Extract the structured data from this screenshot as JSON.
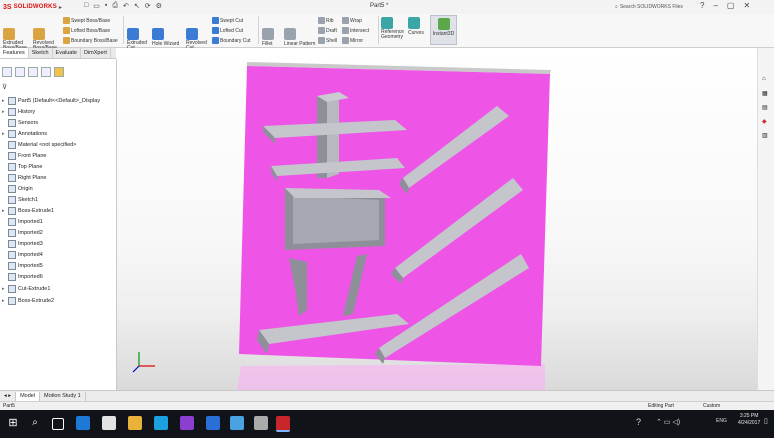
{
  "titlebar": {
    "app_name": "SOLIDWORKS",
    "ds_mark": "3S",
    "document_title": "Part5 *",
    "search_placeholder": "Search SOLIDWORKS Files",
    "quick_icons": [
      "new-icon",
      "open-icon",
      "save-icon",
      "print-icon",
      "undo-icon",
      "select-icon",
      "rebuild-icon",
      "options-icon"
    ]
  },
  "ribbon": {
    "buttons": [
      {
        "label": "Extruded Boss/Base"
      },
      {
        "label": "Revolved Boss/Base"
      },
      {
        "label": "Swept Boss/Base"
      },
      {
        "label": "Lofted Boss/Base"
      },
      {
        "label": "Boundary Boss/Base"
      },
      {
        "label": "Extruded Cut"
      },
      {
        "label": "Hole Wizard"
      },
      {
        "label": "Revolved Cut"
      },
      {
        "label": "Swept Cut"
      },
      {
        "label": "Lofted Cut"
      },
      {
        "label": "Boundary Cut"
      },
      {
        "label": "Fillet"
      },
      {
        "label": "Linear Pattern"
      },
      {
        "label": "Rib"
      },
      {
        "label": "Draft"
      },
      {
        "label": "Shell"
      },
      {
        "label": "Wrap"
      },
      {
        "label": "Intersect"
      },
      {
        "label": "Mirror"
      },
      {
        "label": "Reference Geometry"
      },
      {
        "label": "Curves"
      },
      {
        "label": "Instant3D"
      }
    ]
  },
  "feature_tabs": [
    "Features",
    "Sketch",
    "Evaluate",
    "DimXpert"
  ],
  "tree": [
    {
      "label": "Part5 (Default<<Default>_Display",
      "arrow": "▸"
    },
    {
      "label": "History",
      "arrow": "▸"
    },
    {
      "label": "Sensors",
      "arrow": ""
    },
    {
      "label": "Annotations",
      "arrow": "▸"
    },
    {
      "label": "Material <not specified>",
      "arrow": ""
    },
    {
      "label": "Front Plane",
      "arrow": ""
    },
    {
      "label": "Top Plane",
      "arrow": ""
    },
    {
      "label": "Right Plane",
      "arrow": ""
    },
    {
      "label": "Origin",
      "arrow": ""
    },
    {
      "label": "Sketch1",
      "arrow": ""
    },
    {
      "label": "Boss-Extrude1",
      "arrow": "▸"
    },
    {
      "label": "Imported1",
      "arrow": ""
    },
    {
      "label": "Imported2",
      "arrow": ""
    },
    {
      "label": "Imported3",
      "arrow": ""
    },
    {
      "label": "Imported4",
      "arrow": ""
    },
    {
      "label": "Imported5",
      "arrow": ""
    },
    {
      "label": "Imported6",
      "arrow": ""
    },
    {
      "label": "Cut-Extrude1",
      "arrow": "▸"
    },
    {
      "label": "Boss-Extrude2",
      "arrow": "▸"
    }
  ],
  "bottom_tabs": [
    "Model",
    "Motion Study 1"
  ],
  "status": {
    "left": "Part5",
    "editing": "Editing Part",
    "units": "Custom"
  },
  "clock": {
    "time": "3:25 PM",
    "date": "4/24/2017",
    "lang": "ENG"
  },
  "colors": {
    "plate": "#ee55e6",
    "glyph_top": "#c4c6cc",
    "glyph_side": "#8d9099",
    "taskbar": "#101318"
  }
}
